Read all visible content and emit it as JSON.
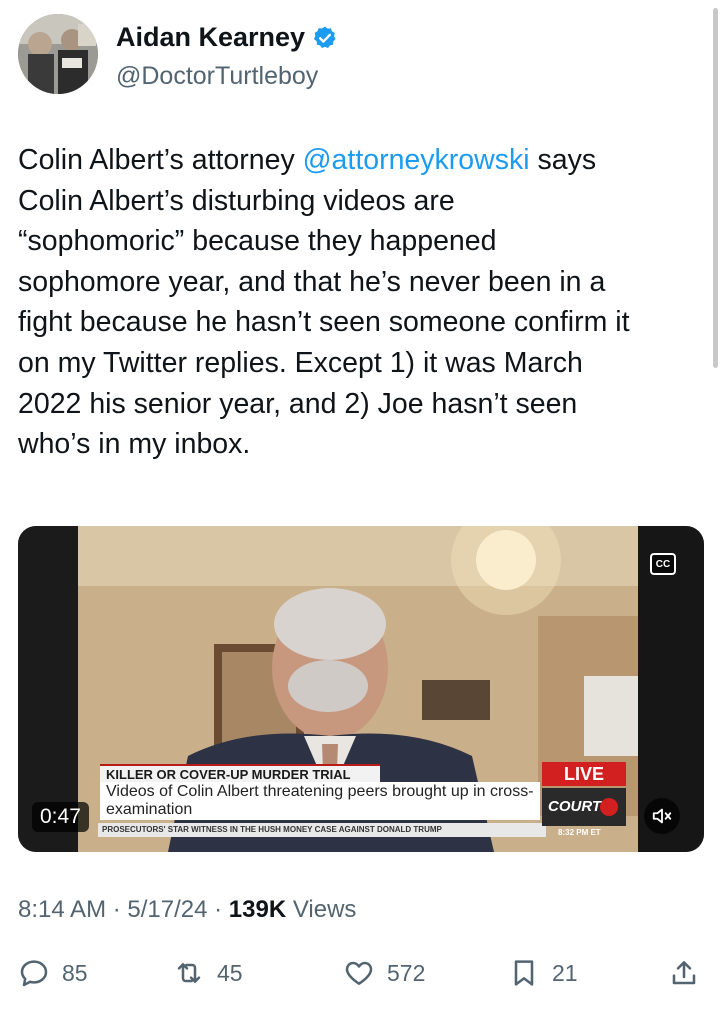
{
  "author": {
    "name": "Aidan Kearney",
    "handle": "@DoctorTurtleboy",
    "verified": true
  },
  "tweet": {
    "lines": [
      [
        "Colin Albert’s attorney ",
        "@attorneykrowski",
        " says"
      ],
      [
        "Colin Albert’s disturbing videos are"
      ],
      [
        "“sophomoric” because they happened"
      ],
      [
        "sophomore year, and that he’s never been in a"
      ],
      [
        "fight because he hasn’t seen someone confirm it"
      ],
      [
        "on my Twitter replies. Except 1) it was March"
      ],
      [
        "2022 his senior year, and 2) Joe hasn’t seen"
      ],
      [
        "who’s in my inbox."
      ]
    ]
  },
  "video": {
    "cc_label": "CC",
    "headline_label": "KILLER OR COVER-UP MURDER TRIAL",
    "caption": "Videos of Colin Albert threatening peers brought up in cross-examination",
    "ticker": "PROSECUTORS' STAR WITNESS IN THE HUSH MONEY CASE AGAINST DONALD TRUMP",
    "live_label": "LIVE",
    "network": "COURT",
    "broadcast_time": "8:32 PM ET",
    "duration": "0:47",
    "mute_icon": "speaker-muted-icon"
  },
  "meta": {
    "time": "8:14 AM",
    "separator": " · ",
    "date": "5/17/24",
    "views_count": "139K",
    "views_label": " Views"
  },
  "actions": {
    "replies": "85",
    "reposts": "45",
    "likes": "572",
    "bookmarks": "21"
  },
  "colors": {
    "text": "#0f1419",
    "secondary": "#536471",
    "mention": "#1d9bf0",
    "verified": "#1d9bf0",
    "live": "#d21f1f"
  }
}
